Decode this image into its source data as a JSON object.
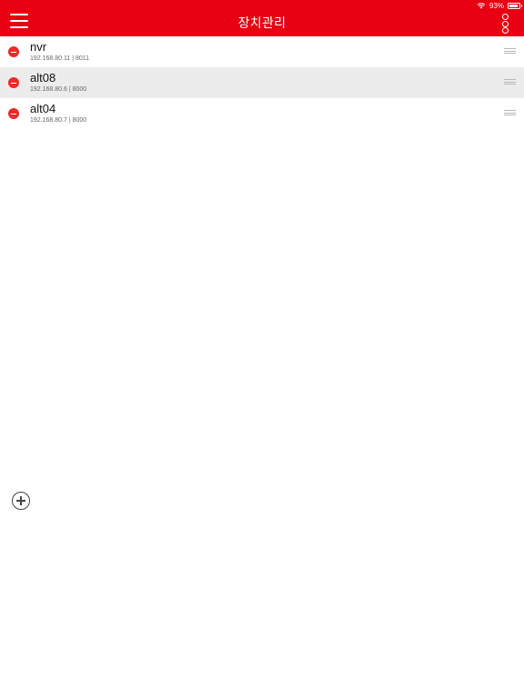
{
  "status": {
    "battery_label": "93%",
    "battery_level": 0.93,
    "icons": [
      "wifi-icon",
      "battery-icon"
    ]
  },
  "header": {
    "title": "장치관리",
    "menu_icon": "hamburger-menu-icon",
    "more_icon": "vertical-more-icon",
    "background_color": "#e60012"
  },
  "devices": [
    {
      "name": "nvr",
      "ip": "192.168.80.11",
      "port": "8011",
      "selected": false
    },
    {
      "name": "alt08",
      "ip": "192.168.80.6",
      "port": "8000",
      "selected": true
    },
    {
      "name": "alt04",
      "ip": "192.168.80.7",
      "port": "8000",
      "selected": false
    }
  ],
  "row_icons": {
    "delete": "minus-circle-icon",
    "reorder": "drag-handle-icon"
  },
  "add_button": {
    "icon": "plus-circle-icon"
  },
  "colors": {
    "accent": "#e60012",
    "delete": "#ee2a2a",
    "selected_row": "#ececec"
  }
}
